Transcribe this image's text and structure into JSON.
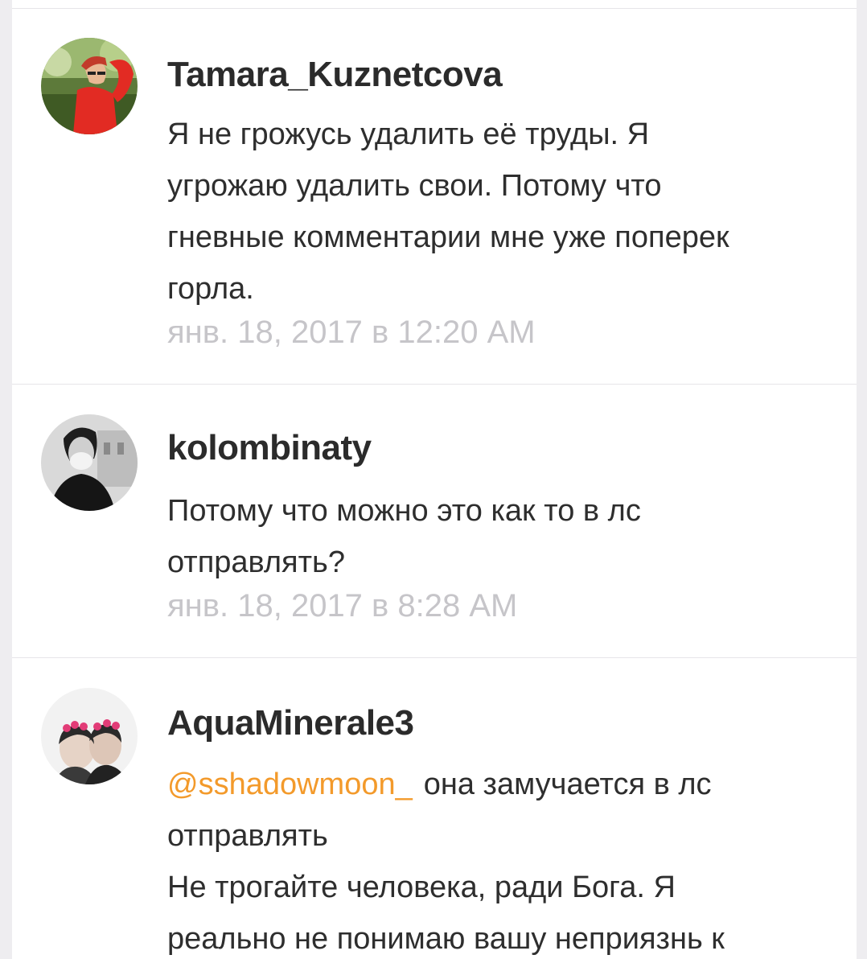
{
  "comments": [
    {
      "username": "Tamara_Kuznetcova",
      "lines": [
        "Я не грожусь удалить её труды. Я",
        "угрожаю удалить свои. Потому что",
        "гневные комментарии мне уже поперек",
        "горла."
      ],
      "timestamp": "янв. 18, 2017 в 12:20 AM"
    },
    {
      "username": "kolombinaty",
      "lines": [
        "Потому что можно это как то в лс",
        "отправлять?"
      ],
      "timestamp": "янв. 18, 2017 в 8:28 AM"
    },
    {
      "username": "AquaMinerale3",
      "mention": "@sshadowmoon_",
      "lines": [
        "она замучается в лс",
        "отправлять",
        "Не трогайте человека, ради Бога. Я",
        "реально не понимаю вашу неприязнь к"
      ]
    }
  ],
  "colors": {
    "mention": "#f39a2b",
    "timestamp": "#c6c5c9",
    "text": "#2e2e2e",
    "background": "#ffffff"
  },
  "icons": {
    "avatar_1": "avatar-photo-woman-red-sleeve",
    "avatar_2": "avatar-photo-man-mask",
    "avatar_3": "avatar-photo-two-people-flower-crowns"
  }
}
